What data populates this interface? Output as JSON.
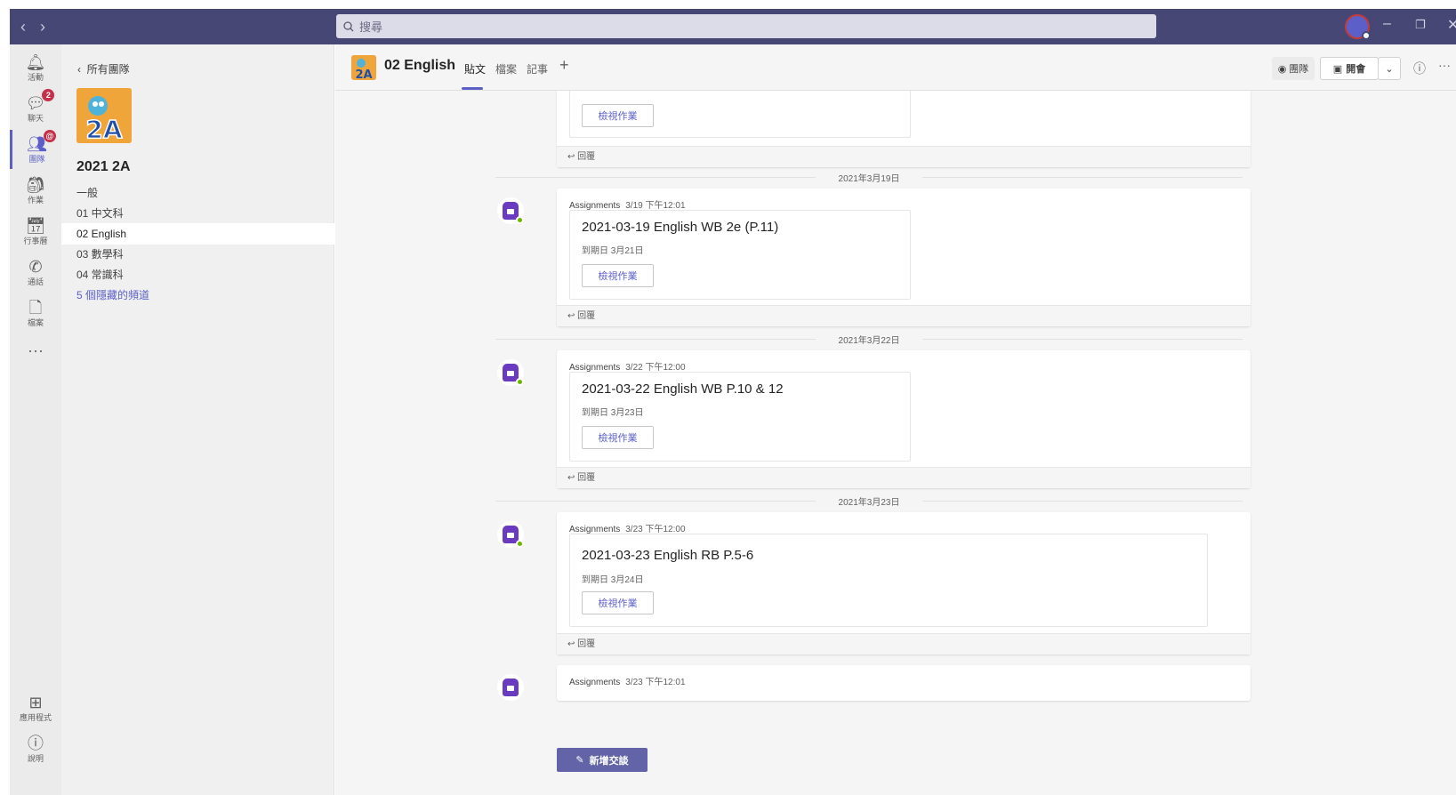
{
  "search": {
    "placeholder": "搜尋"
  },
  "rail": {
    "items": [
      {
        "label": "活動",
        "icon": "bell-icon"
      },
      {
        "label": "聊天",
        "icon": "chat-icon",
        "badge": "2"
      },
      {
        "label": "團隊",
        "icon": "teams-icon",
        "badge": "@"
      },
      {
        "label": "作業",
        "icon": "assignments-icon"
      },
      {
        "label": "行事曆",
        "icon": "calendar-icon"
      },
      {
        "label": "通話",
        "icon": "phone-icon"
      },
      {
        "label": "檔案",
        "icon": "file-icon"
      },
      {
        "label": "···",
        "icon": "more-icon"
      }
    ],
    "apps": "應用程式",
    "help": "說明"
  },
  "teams_pane": {
    "back_label": "所有團隊",
    "team_name": "2021 2A",
    "logo_text": "2A",
    "channels": [
      "一般",
      "01 中文科",
      "02 English",
      "03 數學科",
      "04 常識科"
    ],
    "hidden_channels": "5 個隱藏的頻道"
  },
  "channel_header": {
    "title": "02 English",
    "tabs": [
      "貼文",
      "檔案",
      "記事"
    ],
    "team_btn": "團隊",
    "meet_btn": "開會"
  },
  "posts": [
    {
      "author": "Assignments",
      "time": "3/19 下午12:01",
      "title": "2021-03-19 English WB 2e (P.11)",
      "due": "到期日 3月21日",
      "button": "檢視作業",
      "reply": "回覆",
      "date_sep": "2021年3月19日"
    },
    {
      "author": "Assignments",
      "time": "3/22 下午12:00",
      "title": "2021-03-22 English WB P.10 & 12",
      "due": "到期日 3月23日",
      "button": "檢視作業",
      "reply": "回覆",
      "date_sep": "2021年3月22日"
    },
    {
      "author": "Assignments",
      "time": "3/23 下午12:00",
      "title": "2021-03-23 English RB P.5-6",
      "due": "到期日 3月24日",
      "button": "檢視作業",
      "reply": "回覆",
      "date_sep": "2021年3月23日"
    },
    {
      "author": "Assignments",
      "time": "3/23 下午12:01"
    }
  ],
  "top_post": {
    "button": "檢視作業",
    "reply": "回覆"
  },
  "new_conversation": "新增交談",
  "colors": {
    "titlebar": "#464775",
    "accent": "#5b5fc7",
    "button": "#6264a7"
  }
}
